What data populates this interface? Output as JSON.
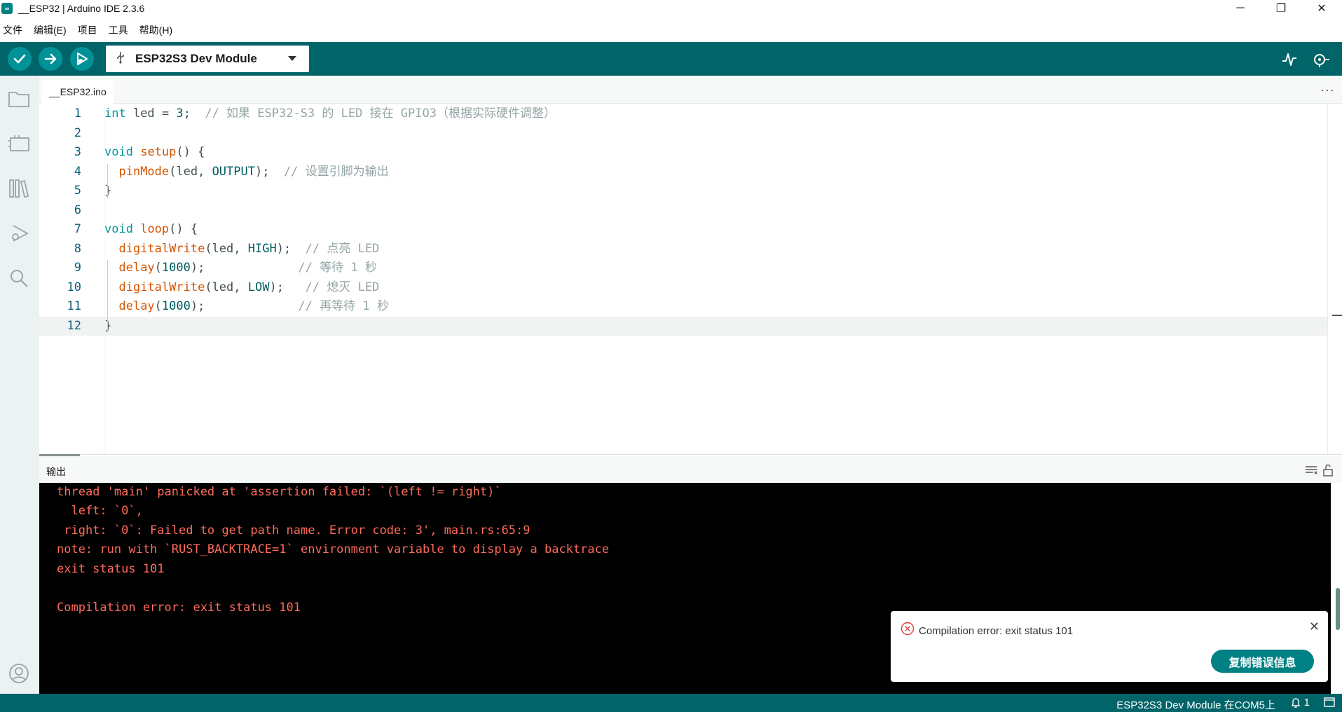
{
  "window": {
    "title": "__ESP32 | Arduino IDE 2.3.6",
    "minimize": "─",
    "restore": "❐",
    "close": "✕"
  },
  "menu": [
    "文件",
    "编辑(E)",
    "项目",
    "工具",
    "帮助(H)"
  ],
  "toolbar": {
    "board": "ESP32S3 Dev Module",
    "icons": [
      "verify-icon",
      "upload-icon",
      "debug-icon",
      "serial-plotter-icon",
      "serial-monitor-icon"
    ]
  },
  "sidebar": {
    "icons": [
      "sketchbook-icon",
      "boards-manager-icon",
      "library-manager-icon",
      "debug-icon",
      "search-icon",
      "profile-icon"
    ]
  },
  "tabs": {
    "file": "__ESP32.ino",
    "more": "···"
  },
  "editor": {
    "lines": [
      {
        "n": "1",
        "code": [
          [
            "kw-type",
            "int"
          ],
          [
            "plain",
            " led = "
          ],
          [
            "num",
            "3"
          ],
          [
            "plain",
            ";  "
          ],
          [
            "comment",
            "// 如果 ESP32-S3 的 LED 接在 GPIO3（根据实际硬件调整）"
          ]
        ]
      },
      {
        "n": "2",
        "code": []
      },
      {
        "n": "3",
        "code": [
          [
            "kw-type",
            "void"
          ],
          [
            "plain",
            " "
          ],
          [
            "kw-fn",
            "setup"
          ],
          [
            "plain",
            "() {"
          ]
        ]
      },
      {
        "n": "4",
        "code": [
          [
            "plain",
            "  "
          ],
          [
            "kw-fn",
            "pinMode"
          ],
          [
            "plain",
            "(led, "
          ],
          [
            "kw-const",
            "OUTPUT"
          ],
          [
            "plain",
            ");  "
          ],
          [
            "comment",
            "// 设置引脚为输出"
          ]
        ]
      },
      {
        "n": "5",
        "code": [
          [
            "plain",
            "}"
          ]
        ]
      },
      {
        "n": "6",
        "code": []
      },
      {
        "n": "7",
        "code": [
          [
            "kw-type",
            "void"
          ],
          [
            "plain",
            " "
          ],
          [
            "kw-fn",
            "loop"
          ],
          [
            "plain",
            "() {"
          ]
        ]
      },
      {
        "n": "8",
        "code": [
          [
            "plain",
            "  "
          ],
          [
            "kw-fn",
            "digitalWrite"
          ],
          [
            "plain",
            "(led, "
          ],
          [
            "kw-const",
            "HIGH"
          ],
          [
            "plain",
            ");  "
          ],
          [
            "comment",
            "// 点亮 LED"
          ]
        ]
      },
      {
        "n": "9",
        "code": [
          [
            "plain",
            "  "
          ],
          [
            "kw-fn",
            "delay"
          ],
          [
            "plain",
            "("
          ],
          [
            "num",
            "1000"
          ],
          [
            "plain",
            ");             "
          ],
          [
            "comment",
            "// 等待 1 秒"
          ]
        ]
      },
      {
        "n": "10",
        "code": [
          [
            "plain",
            "  "
          ],
          [
            "kw-fn",
            "digitalWrite"
          ],
          [
            "plain",
            "(led, "
          ],
          [
            "kw-const",
            "LOW"
          ],
          [
            "plain",
            ");   "
          ],
          [
            "comment",
            "// 熄灭 LED"
          ]
        ]
      },
      {
        "n": "11",
        "code": [
          [
            "plain",
            "  "
          ],
          [
            "kw-fn",
            "delay"
          ],
          [
            "plain",
            "("
          ],
          [
            "num",
            "1000"
          ],
          [
            "plain",
            ");             "
          ],
          [
            "comment",
            "// 再等待 1 秒"
          ]
        ]
      },
      {
        "n": "12",
        "code": [
          [
            "plain",
            "}"
          ]
        ]
      }
    ],
    "active_line": 12
  },
  "output": {
    "title": "输出",
    "lines": [
      "thread 'main' panicked at 'assertion failed: `(left != right)`",
      "  left: `0`,",
      " right: `0`: Failed to get path name. Error code: 3', main.rs:65:9",
      "note: run with `RUST_BACKTRACE=1` environment variable to display a backtrace",
      "exit status 101",
      "",
      "Compilation error: exit status 101"
    ]
  },
  "toast": {
    "message": "Compilation error: exit status 101",
    "button": "复制错误信息",
    "close": "✕"
  },
  "status": {
    "board": "ESP32S3 Dev Module 在COM5上",
    "notifications": "1"
  },
  "colors": {
    "toolbar": "#006468",
    "accent": "#008184",
    "error_text": "#ff6b5b"
  }
}
